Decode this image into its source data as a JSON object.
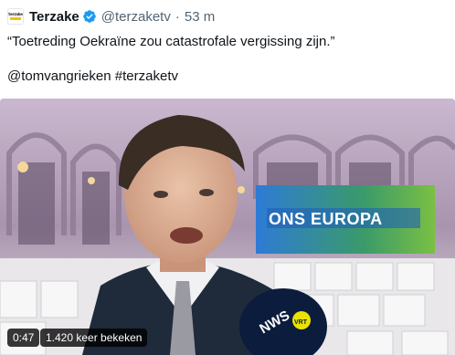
{
  "tweet": {
    "display_name": "Terzake",
    "handle": "@terzaketv",
    "separator": "·",
    "time": "53 m",
    "text_line1": "“Toetreding Oekraïne zou catastrofale vergissing zijn.”",
    "mention": "@tomvangrieken",
    "hashtag": "#terzaketv",
    "avatar_logo_text": "terzake",
    "verified_icon": "verified-badge-icon",
    "accent_color": "#1d9bf0"
  },
  "video": {
    "duration": "0:47",
    "views": "1.420 keer bekeken",
    "banner_text": "ONS EUROPA",
    "mic_logo_text": "NWS",
    "mic_badge_text": "VRT"
  }
}
